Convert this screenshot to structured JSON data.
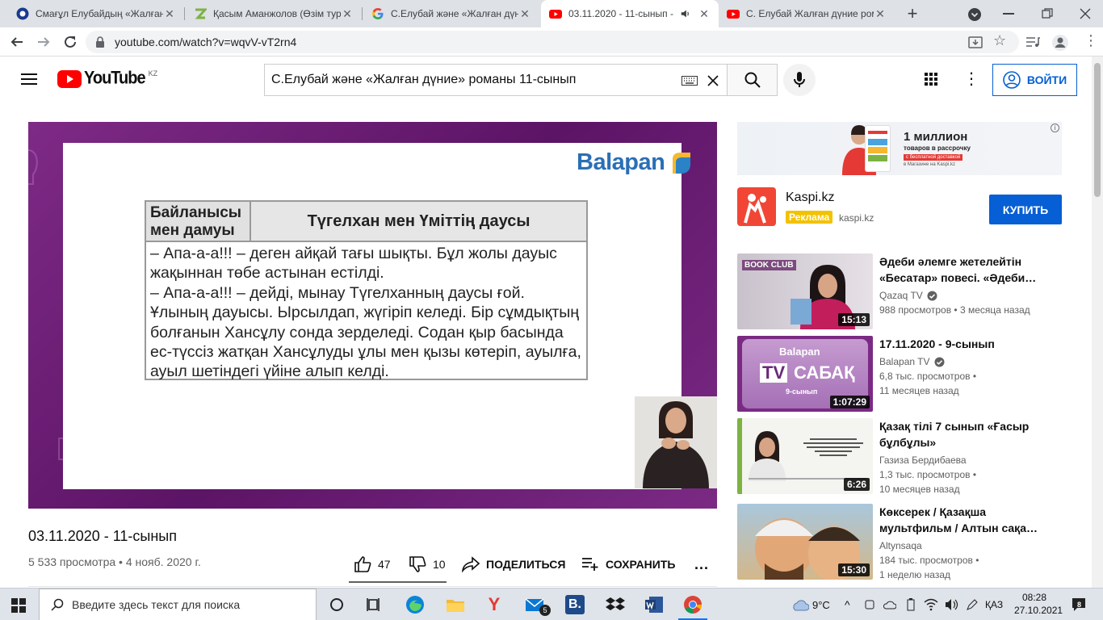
{
  "tabs": [
    {
      "title": "Смағұл Елубайдың «Жалған дү",
      "fav": "#1a3a8f"
    },
    {
      "title": "Қасым Аманжолов (Өзім тура",
      "fav": "#7cb342"
    },
    {
      "title": "С.Елубай және «Жалған дүние",
      "fav": "google"
    },
    {
      "title": "03.11.2020 - 11-сынып -",
      "fav": "youtube",
      "active": true
    },
    {
      "title": "С. Елубай Жалған дүние ром",
      "fav": "youtube"
    }
  ],
  "browser": {
    "url": "youtube.com/watch?v=wqvV-vT2rn4"
  },
  "youtube": {
    "logo_text": "YouTube",
    "region": "KZ",
    "search_value": "С.Елубай және «Жалған дүние» романы 11-сынып",
    "signin": "ВОЙТИ"
  },
  "slide": {
    "brand": "Balapan",
    "header_left": "Байланысы мен дамуы",
    "header_right": "Түгелхан мен Үміттің  даусы",
    "body": "– Апа-а-а!!! – деген айқай тағы шықты. Бұл жолы дауыс жақыннан төбе астынан естілді.\n– Апа-а-а!!! – дейді, мынау Түгелханның даусы ғой. Ұлының дауысы. Ырсылдап, жүгіріп келеді. Бір сұмдықтың болғанын Хансұлу сонда зерделеді. Содан қыр басында ес-түссіз жатқан Хансұлуды ұлы мен қызы көтеріп, ауылға, ауыл шетіндегі үйіне алып келді."
  },
  "video": {
    "title": "03.11.2020 - 11-сынып",
    "meta": "5 533 просмотра • 4 нояб. 2020 г.",
    "likes": "47",
    "dislikes": "10",
    "share": "ПОДЕЛИТЬСЯ",
    "save": "СОХРАНИТЬ",
    "more": "..."
  },
  "ad": {
    "banner_line1": "1 миллион",
    "banner_line2": "товаров в рассрочку",
    "banner_line3": "с бесплатной доставкой",
    "banner_line4": "в Магазине на Kaspi.kz",
    "advertiser": "Kaspi.kz",
    "badge": "Реклама",
    "domain": "kaspi.kz",
    "cta": "КУПИТЬ"
  },
  "recommendations": [
    {
      "title": "Әдеби әлемге жетелейтін «Бесатар» повесі. «Әдеби…",
      "channel": "Qazaq TV",
      "verified": true,
      "views": "988 просмотров",
      "age": "3 месяца назад",
      "duration": "15:13",
      "thumb_text": "BOOK CLUB"
    },
    {
      "title": "17.11.2020 - 9-сынып",
      "channel": "Balapan TV",
      "verified": true,
      "views": "6,8 тыс. просмотров",
      "age": "11 месяцев назад",
      "duration": "1:07:29",
      "thumb_brand": "Balapan",
      "thumb_tv": "TV",
      "thumb_sabak": "САБАҚ",
      "thumb_grade": "9-сынып"
    },
    {
      "title": "Қазақ тілі 7 сынып «Ғасыр бұлбұлы»",
      "channel": "Газиза Бердибаева",
      "verified": false,
      "views": "1,3 тыс. просмотров",
      "age": "10 месяцев назад",
      "duration": "6:26"
    },
    {
      "title": "Көксерек / Қазақша мультфильм / Алтын сақа…",
      "channel": "Altynsaqa",
      "verified": false,
      "views": "184 тыс. просмотров",
      "age": "1 неделю назад",
      "duration": "15:30"
    }
  ],
  "taskbar": {
    "search_placeholder": "Введите здесь текст для поиска",
    "weather": "9°C",
    "lang": "ҚАЗ",
    "time": "08:28",
    "date": "27.10.2021",
    "mail_badge": "5",
    "notif": "8"
  }
}
